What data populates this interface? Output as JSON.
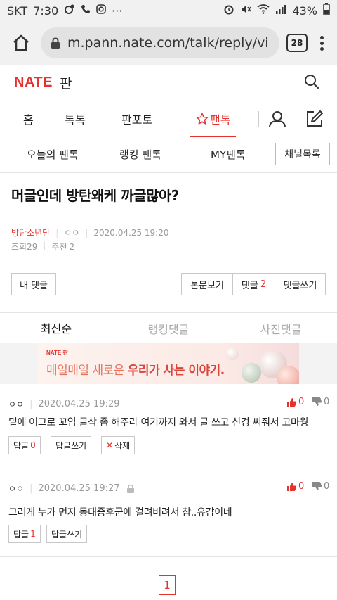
{
  "status_bar": {
    "carrier": "SKT",
    "time": "7:30",
    "dots": "···",
    "battery": "43%"
  },
  "browser": {
    "url": "m.pann.nate.com/talk/reply/vi",
    "tab_count": "28"
  },
  "header": {
    "logo": "NATE",
    "section": "판"
  },
  "main_nav": [
    {
      "label": "홈"
    },
    {
      "label": "톡톡"
    },
    {
      "label": "판포토"
    },
    {
      "label": "팬톡",
      "active": true
    }
  ],
  "sub_nav": {
    "items": [
      "오늘의 팬톡",
      "랭킹 팬톡",
      "MY팬톡"
    ],
    "channel_button": "채널목록"
  },
  "article": {
    "title": "머글인데 방탄왜케 까글많아?",
    "channel": "방탄소년단",
    "author": "ㅇㅇ",
    "datetime": "2020.04.25 19:20",
    "views_label": "조회",
    "views": "29",
    "recommend_label": "추천",
    "recommend": "2"
  },
  "actions": {
    "my_comments": "내 댓글",
    "view_body": "본문보기",
    "comments": "댓글",
    "comment_count": "2",
    "write_comment": "댓글쓰기"
  },
  "comment_tabs": [
    "최신순",
    "랭킹댓글",
    "사진댓글"
  ],
  "banner": {
    "logo": "NATE 판",
    "text_plain": "매일매일 새로운 ",
    "text_bold": "우리가 사는 이야기."
  },
  "comments": [
    {
      "author": "ㅇㅇ",
      "datetime": "2020.04.25 19:29",
      "up": "0",
      "down": "0",
      "text": "밑에 어그로 꼬임 글삭 좀 해주라 여기까지 와서 글 쓰고 신경 써줘서 고마웡",
      "reply_label": "답글",
      "reply_count": "0",
      "write_reply": "답글쓰기",
      "delete": "삭제"
    },
    {
      "author": "ㅇㅇ",
      "datetime": "2020.04.25 19:27",
      "up": "0",
      "down": "0",
      "text": "그러게 누가 먼저 동태증후군에 걸려버려서 참..유감이네",
      "reply_label": "답글",
      "reply_count": "1",
      "write_reply": "답글쓰기"
    }
  ],
  "pagination": {
    "current": "1"
  },
  "colors": {
    "accent": "#e5322d",
    "text": "#222222",
    "muted": "#999999"
  }
}
